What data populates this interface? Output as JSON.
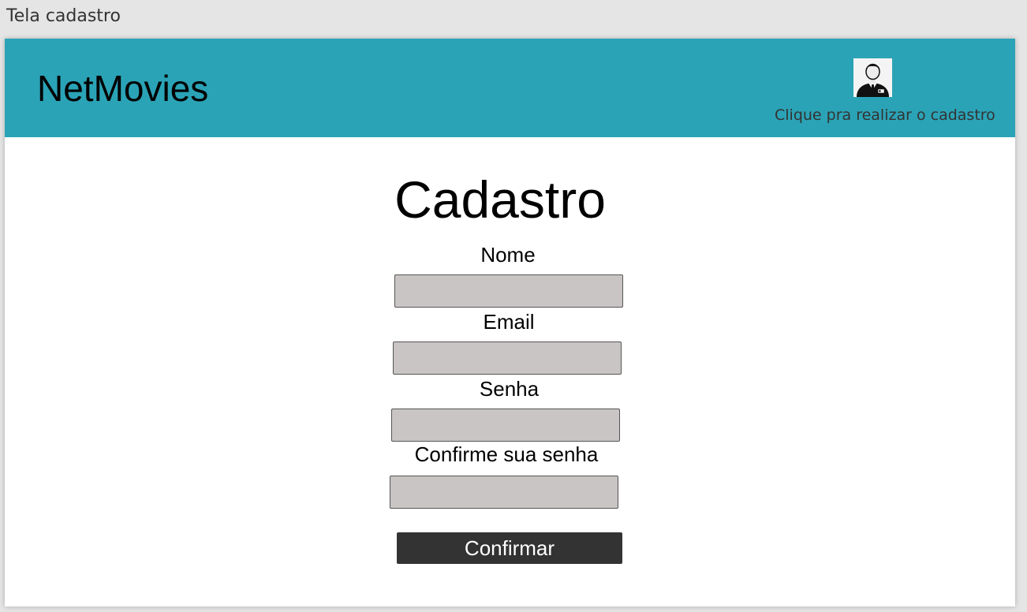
{
  "window": {
    "title": "Tela cadastro"
  },
  "header": {
    "brand": "NetMovies",
    "avatar_icon": "user-avatar-icon",
    "signup_link": "Clique pra realizar o cadastro",
    "background_color": "#2ba3b6"
  },
  "form": {
    "title": "Cadastro",
    "fields": [
      {
        "label": "Nome",
        "value": "",
        "placeholder": ""
      },
      {
        "label": "Email",
        "value": "",
        "placeholder": ""
      },
      {
        "label": "Senha",
        "value": "",
        "placeholder": ""
      },
      {
        "label": "Confirme sua senha",
        "value": "",
        "placeholder": ""
      }
    ],
    "confirm_label": "Confirmar",
    "input_color": "#c9c5c4",
    "button_color": "#333333"
  }
}
